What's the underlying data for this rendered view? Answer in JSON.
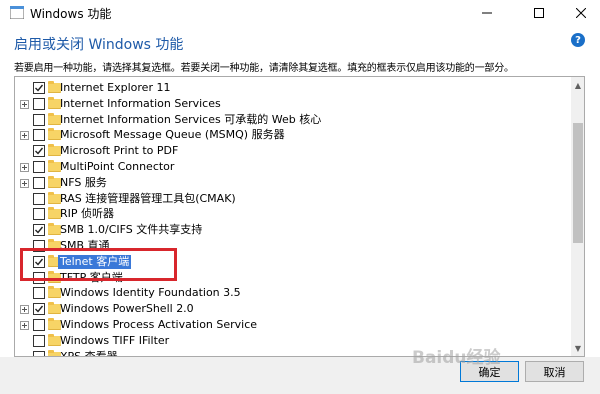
{
  "window": {
    "title": "Windows 功能",
    "heading": "启用或关闭 Windows 功能",
    "instruction": "若要启用一种功能，请选择其复选框。若要关闭一种功能，请清除其复选框。填充的框表示仅启用该功能的一部分。",
    "help_icon": "?",
    "minimize_icon": "minimize-icon",
    "maximize_icon": "maximize-icon",
    "close_icon": "close-icon"
  },
  "features": [
    {
      "label": "Internet Explorer 11",
      "checked": true,
      "expandable": false
    },
    {
      "label": "Internet Information Services",
      "checked": false,
      "expandable": true
    },
    {
      "label": "Internet Information Services 可承载的 Web 核心",
      "checked": false,
      "expandable": false
    },
    {
      "label": "Microsoft Message Queue (MSMQ) 服务器",
      "checked": false,
      "expandable": true
    },
    {
      "label": "Microsoft Print to PDF",
      "checked": true,
      "expandable": false
    },
    {
      "label": "MultiPoint Connector",
      "checked": false,
      "expandable": true
    },
    {
      "label": "NFS 服务",
      "checked": false,
      "expandable": true
    },
    {
      "label": "RAS 连接管理器管理工具包(CMAK)",
      "checked": false,
      "expandable": false
    },
    {
      "label": "RIP 侦听器",
      "checked": false,
      "expandable": false
    },
    {
      "label": "SMB 1.0/CIFS 文件共享支持",
      "checked": true,
      "expandable": false
    },
    {
      "label": "SMB 直通",
      "checked": false,
      "expandable": false
    },
    {
      "label": "Telnet 客户端",
      "checked": true,
      "expandable": false,
      "selected": true
    },
    {
      "label": "TFTP 客户端",
      "checked": false,
      "expandable": false
    },
    {
      "label": "Windows Identity Foundation 3.5",
      "checked": false,
      "expandable": false
    },
    {
      "label": "Windows PowerShell 2.0",
      "checked": true,
      "expandable": true
    },
    {
      "label": "Windows Process Activation Service",
      "checked": false,
      "expandable": true
    },
    {
      "label": "Windows TIFF IFilter",
      "checked": false,
      "expandable": false
    },
    {
      "label": "XPS 查看器",
      "checked": false,
      "expandable": false
    }
  ],
  "buttons": {
    "ok": "确定",
    "cancel": "取消"
  },
  "watermark": "Baidu经验",
  "colors": {
    "heading": "#1e5aa8",
    "selection": "#3a78d8",
    "highlight_box": "#d8262c"
  }
}
